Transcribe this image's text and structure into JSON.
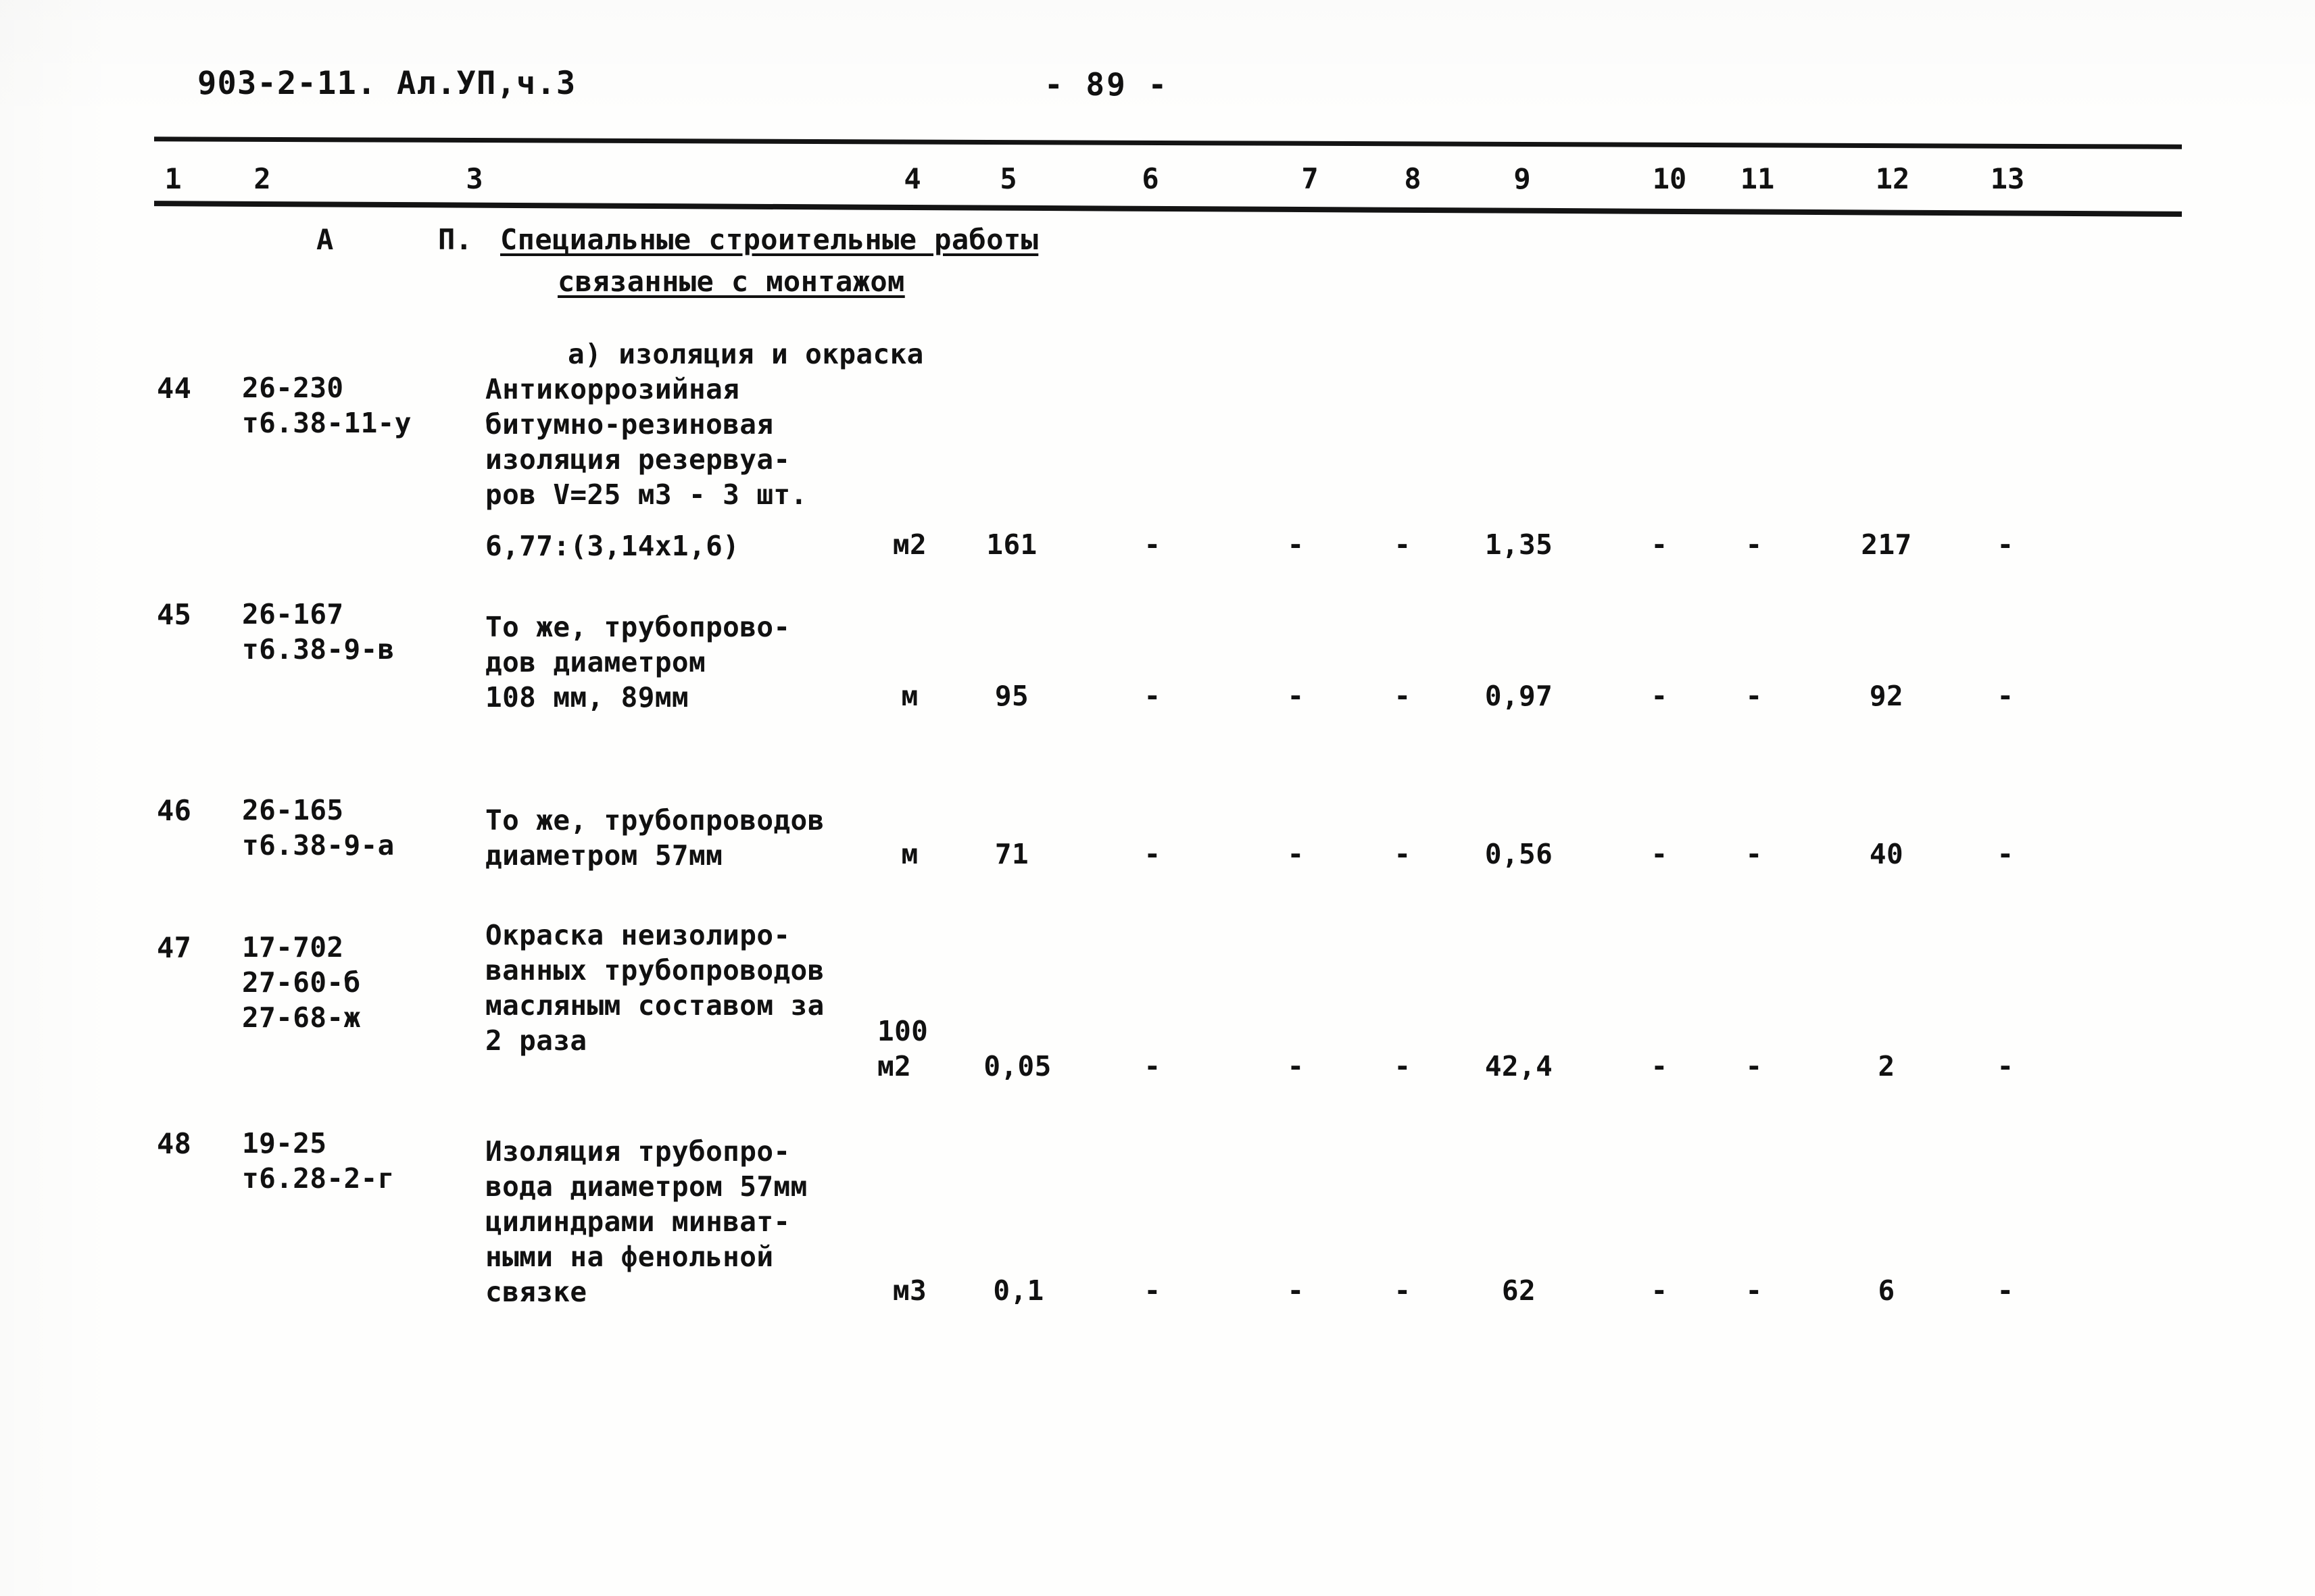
{
  "header": {
    "doc_code": "903-2-11. Ал.УП,ч.3",
    "page_number": "- 89 -"
  },
  "table": {
    "column_numbers": [
      "1",
      "2",
      "3",
      "4",
      "5",
      "6",
      "7",
      "8",
      "9",
      "10",
      "11",
      "12",
      "13"
    ],
    "section": {
      "letter": "А",
      "number": "П.",
      "title_line1": "Специальные строительные работы",
      "title_line2": "связанные с монтажом",
      "subsection": "а) изоляция и окраска"
    },
    "rows": [
      {
        "num": "44",
        "code_line1": "26-230",
        "code_line2": "т6.38-11-у",
        "desc_line1": "Антикоррозийная",
        "desc_line2": "битумно-резиновая",
        "desc_line3": "изоляция резервуа-",
        "desc_line4": "ров V=25 м3 - 3 шт.",
        "formula": "6,77:(3,14х1,6)",
        "unit": "м2",
        "c5": "161",
        "c6": "-",
        "c7": "-",
        "c8": "-",
        "c9": "1,35",
        "c10": "-",
        "c11": "-",
        "c12": "217",
        "c13": "-"
      },
      {
        "num": "45",
        "code_line1": "26-167",
        "code_line2": "т6.38-9-в",
        "desc_line1": "То же, трубопрово-",
        "desc_line2": "дов диаметром",
        "desc_line3": "108 мм, 89мм",
        "unit": "м",
        "c5": "95",
        "c6": "-",
        "c7": "-",
        "c8": "-",
        "c9": "0,97",
        "c10": "-",
        "c11": "-",
        "c12": "92",
        "c13": "-"
      },
      {
        "num": "46",
        "code_line1": "26-165",
        "code_line2": "т6.38-9-а",
        "desc_line1": "То же, трубопроводов",
        "desc_line2": "диаметром 57мм",
        "unit": "м",
        "c5": "71",
        "c6": "-",
        "c7": "-",
        "c8": "-",
        "c9": "0,56",
        "c10": "-",
        "c11": "-",
        "c12": "40",
        "c13": "-"
      },
      {
        "num": "47",
        "code_line1": "17-702",
        "code_line2": "27-60-б",
        "code_line3": "27-68-ж",
        "desc_line1": "Окраска неизолиро-",
        "desc_line2": "ванных трубопроводов",
        "desc_line3": "масляным составом за",
        "desc_line4": "2 раза",
        "unit_line1": "100",
        "unit_line2": "м2",
        "c5": "0,05",
        "c6": "-",
        "c7": "-",
        "c8": "-",
        "c9": "42,4",
        "c10": "-",
        "c11": "-",
        "c12": "2",
        "c13": "-"
      },
      {
        "num": "48",
        "code_line1": "19-25",
        "code_line2": "т6.28-2-г",
        "desc_line1": "Изоляция трубопро-",
        "desc_line2": "вода диаметром 57мм",
        "desc_line3": "цилиндрами минват-",
        "desc_line4": "ными на фенольной",
        "desc_line5": "связке",
        "unit": "м3",
        "c5": "0,1",
        "c6": "-",
        "c7": "-",
        "c8": "-",
        "c9": "62",
        "c10": "-",
        "c11": "-",
        "c12": "6",
        "c13": "-"
      }
    ]
  }
}
